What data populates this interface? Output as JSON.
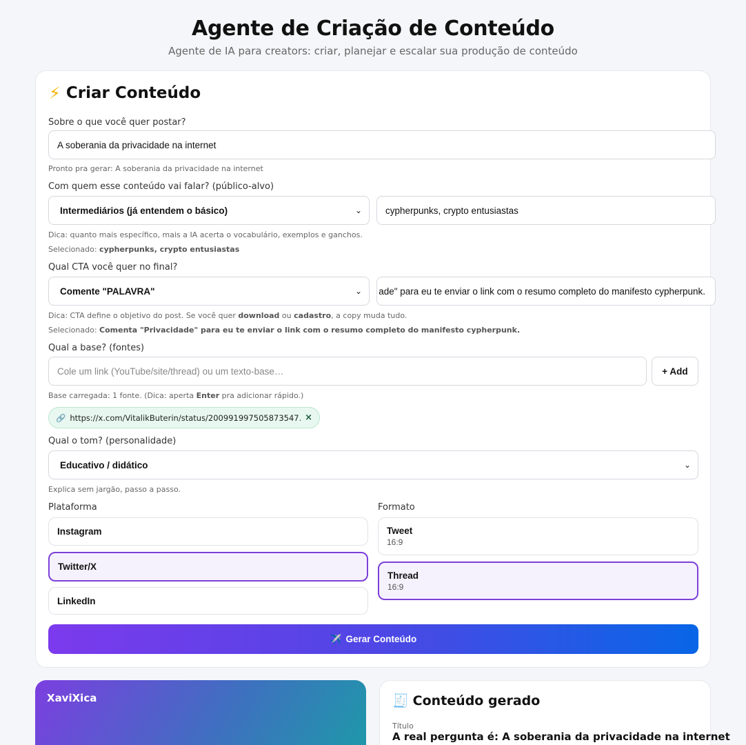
{
  "header": {
    "title": "Agente de Criação de Conteúdo",
    "subtitle": "Agente de IA para creators: criar, planejar e escalar sua produção de conteúdo"
  },
  "create": {
    "title": "Criar Conteúdo",
    "topic_label": "Sobre o que você quer postar?",
    "topic_value": "A soberania da privacidade na internet",
    "topic_hint": "Pronto pra gerar: A soberania da privacidade na internet",
    "audience_label": "Com quem esse conteúdo vai falar? (público-alvo)",
    "audience_level": "Intermediários (já entendem o básico)",
    "audience_custom": "cypherpunks, crypto entusiastas",
    "audience_hint": "Dica: quanto mais específico, mais a IA acerta o vocabulário, exemplos e ganchos.",
    "audience_selected_prefix": "Selecionado: ",
    "audience_selected": "cypherpunks, crypto entusiastas",
    "cta_label": "Qual CTA você quer no final?",
    "cta_type": "Comente \"PALAVRA\"",
    "cta_custom": "ade\" para eu te enviar o link com o resumo completo do manifesto cypherpunk.",
    "cta_hint_1": "Dica: CTA define o objetivo do post. Se você quer ",
    "cta_hint_download": "download",
    "cta_hint_2": " ou ",
    "cta_hint_cadastro": "cadastro",
    "cta_hint_3": ", a copy muda tudo.",
    "cta_selected_prefix": "Selecionado: ",
    "cta_selected": "Comenta \"Privacidade\" para eu te enviar o link com o resumo completo do manifesto cypherpunk.",
    "sources_label": "Qual a base? (fontes)",
    "sources_placeholder": "Cole um link (YouTube/site/thread) ou um texto-base…",
    "sources_add": "+ Add",
    "sources_hint_1": "Base carregada: 1 fonte. (Dica: aperta ",
    "sources_hint_enter": "Enter",
    "sources_hint_2": " pra adicionar rápido.)",
    "source_chip": "https://x.com/VitalikButerin/status/200991997505873547…",
    "tone_label": "Qual o tom? (personalidade)",
    "tone_value": "Educativo / didático",
    "tone_hint": "Explica sem jargão, passo a passo.",
    "platform_label": "Plataforma",
    "platforms": [
      "Instagram",
      "Twitter/X",
      "LinkedIn"
    ],
    "selected_platform": "Twitter/X",
    "format_label": "Formato",
    "formats": [
      {
        "name": "Tweet",
        "ratio": "16:9"
      },
      {
        "name": "Thread",
        "ratio": "16:9"
      }
    ],
    "selected_format": "Thread",
    "generate_label": "Gerar Conteúdo"
  },
  "preview": {
    "name": "XaviXica"
  },
  "output": {
    "title": "Conteúdo gerado",
    "title_label": "Título",
    "title_value": "A real pergunta é: A soberania da privacidade na internet"
  },
  "colors": {
    "accent": "#7c3fd8",
    "chip_bg": "#e8f8f0",
    "button_gradient": [
      "#7c3aed",
      "#4f46e5",
      "#0866e6"
    ]
  }
}
